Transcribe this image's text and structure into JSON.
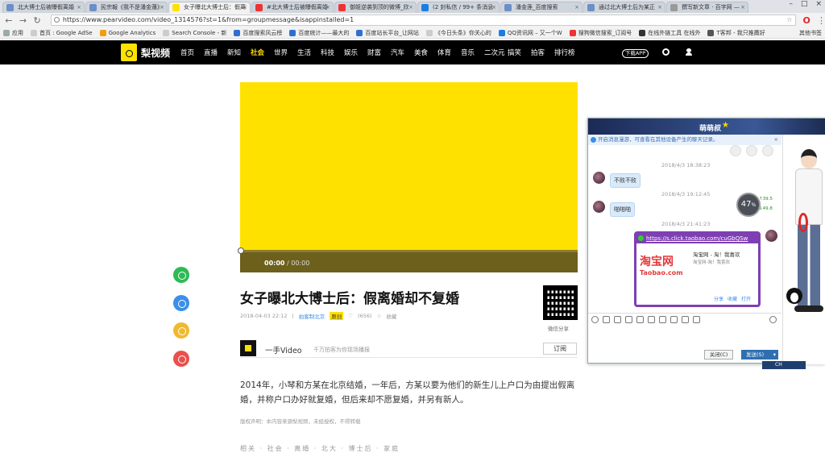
{
  "tabs": [
    {
      "label": "北大博士后被曝假离婚"
    },
    {
      "label": "民宗報《我不是潘金蓮》"
    },
    {
      "label": "女子曝北大博士后：假离"
    },
    {
      "label": "#北大博士后被曝假离婚"
    },
    {
      "label": "御姐逆袭到顶的微博_欣"
    },
    {
      "label": "(2 封私信 / 99+ 条消息"
    },
    {
      "label": "潘金莲_百度搜索"
    },
    {
      "label": "通过北大博士后为某正"
    },
    {
      "label": "撰写新文章 · 百字网 —"
    }
  ],
  "address": {
    "url": "https://www.pearvideo.com/video_1314576?st=1&from=groupmessage&isappinstalled=1"
  },
  "bookmarks": [
    {
      "label": "应用"
    },
    {
      "label": "首页 : Google AdSe"
    },
    {
      "label": "Google Analytics"
    },
    {
      "label": "Search Console - 新"
    },
    {
      "label": "百度搜索风云榜"
    },
    {
      "label": "百度统计——最大的"
    },
    {
      "label": "百度站长平台_让网站"
    },
    {
      "label": "《今日头条》你关心的"
    },
    {
      "label": "QQ资讯网 – 又一个W"
    },
    {
      "label": "搜狗微信搜索_订阅号"
    },
    {
      "label": "在线外链工具 在线外"
    },
    {
      "label": "T客邦 - 我只推薦好"
    }
  ],
  "bookmarks_other": "其他书签",
  "site": {
    "logo_text": "梨视频",
    "menu": [
      "首页",
      "直播",
      "新知",
      "社会",
      "世界",
      "生活",
      "科技",
      "娱乐",
      "财富",
      "汽车",
      "美食",
      "体育",
      "音乐",
      "二次元",
      "搞笑",
      "拍客",
      "排行榜"
    ],
    "active_menu": "社会",
    "download_app": "下载APP"
  },
  "player": {
    "current_time": "00:00",
    "duration": "/ 00:00",
    "progress_fraction": 0
  },
  "article": {
    "title": "女子曝北大博士后：假离婚却不复婚",
    "date": "2018-04-03 22:12",
    "source": "拍客制北京",
    "tag": "原创",
    "likes": "(656)",
    "favorite": "收藏",
    "qr_label": "微信分享",
    "author_name": "一手Video",
    "author_slogan": "千万拍客为你现场播报",
    "follow": "订阅",
    "description": "2014年，小琴和方某在北京结婚，一年后，方某以要为他们的新生儿上户口为由提出假离婚，并称户口办好就复婚，但后来却不愿复婚，并另有新人。",
    "copyright": "版权声明：本内容来源梨视频，未经授权，不得转载",
    "tail": "相关 · 社会 · 离婚 · 北大 · 博士后 · 家庭"
  },
  "share_colors": {
    "wechat": "#2dbb55",
    "qq": "#3b8fe8",
    "qzone": "#f0b92e",
    "weibo": "#e9514c"
  },
  "chat": {
    "name": "萌萌叔",
    "notice": "开启消息漫游，可查看在其他设备产生的聊天记录。",
    "messages": [
      {
        "time": "2018/4/3 18:38:23",
        "text": "不败不败"
      },
      {
        "time": "2018/4/3 19:12:45",
        "text": "啪啪啪"
      },
      {
        "time": "2018/4/3 21:41:23",
        "link": "https://s.click.taobao.com/cuGbQSw"
      }
    ],
    "card": {
      "logo_cn": "淘宝网",
      "logo_en": "Taobao.com",
      "title": "淘宝网 - 淘！我喜欢",
      "subtitle": "淘宝网-淘！我喜欢",
      "actions": [
        "分享",
        "收藏",
        "打开"
      ]
    },
    "speed": {
      "value": "47",
      "unit": "%",
      "up": "39.5",
      "down": "49.8"
    },
    "close_label": "关闭(C)",
    "send_label": "发送(S)",
    "tray_label": "CH"
  }
}
